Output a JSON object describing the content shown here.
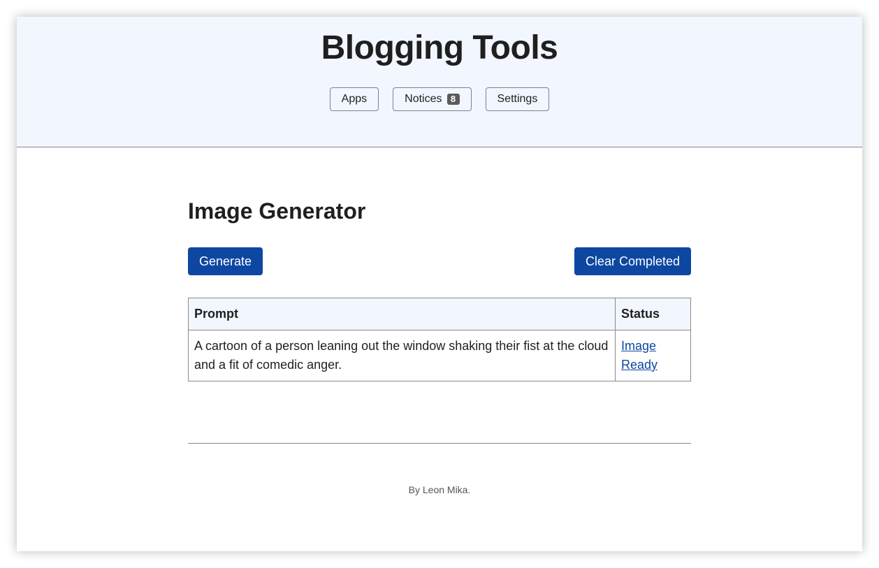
{
  "header": {
    "title": "Blogging Tools",
    "nav": {
      "apps_label": "Apps",
      "notices_label": "Notices",
      "notices_count": "8",
      "settings_label": "Settings"
    }
  },
  "main": {
    "title": "Image Generator",
    "actions": {
      "generate_label": "Generate",
      "clear_label": "Clear Completed"
    },
    "table": {
      "columns": [
        "Prompt",
        "Status"
      ],
      "rows": [
        {
          "prompt": "A cartoon of a person leaning out the window shaking their fist at the cloud and a fit of comedic anger.",
          "status": "Image Ready"
        }
      ]
    }
  },
  "footer": {
    "text": "By Leon Mika."
  },
  "colors": {
    "header_bg": "#f2f6fe",
    "primary": "#0d47a1",
    "border": "#8a8a8a"
  }
}
